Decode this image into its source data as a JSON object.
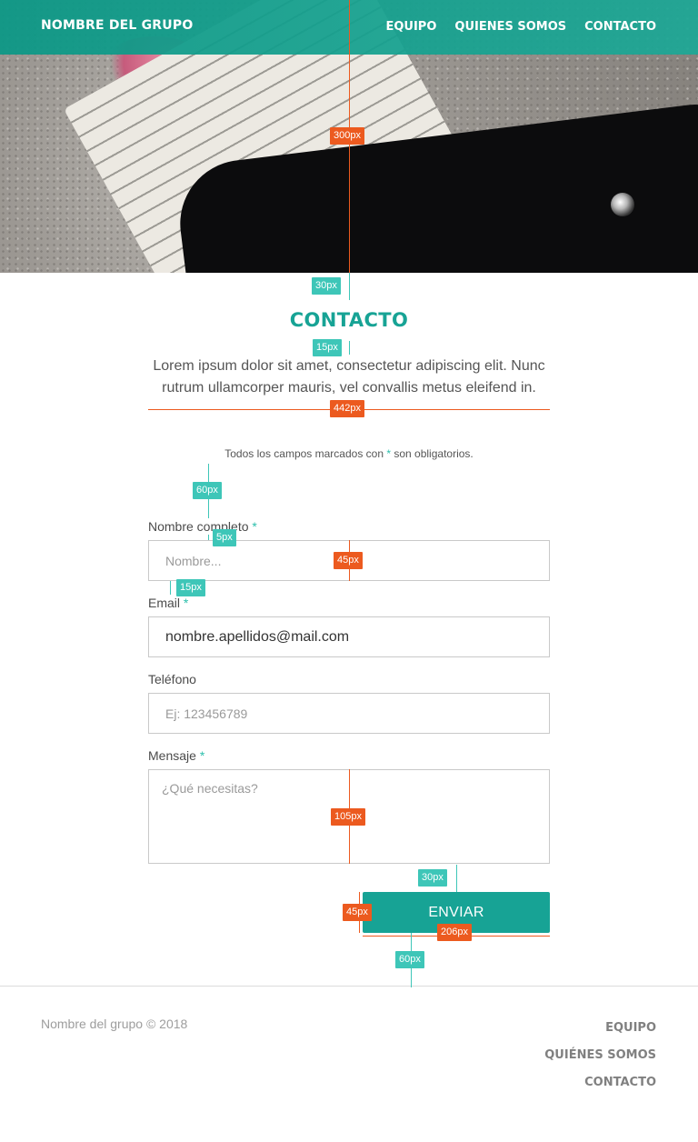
{
  "header": {
    "brand": "NOMBRE DEL GRUPO",
    "nav": [
      "EQUIPO",
      "QUIENES SOMOS",
      "CONTACTO"
    ]
  },
  "section": {
    "title": "CONTACTO",
    "lead": "Lorem ipsum dolor sit amet, consectetur adipiscing elit. Nunc rutrum ullamcorper mauris, vel convallis metus eleifend in.",
    "required_note_before": "Todos los campos marcados con",
    "required_note_star": "*",
    "required_note_after": "son obligatorios."
  },
  "form": {
    "name_label": "Nombre completo",
    "name_placeholder": "Nombre...",
    "email_label": "Email",
    "email_value": "nombre.apellidos@mail.com",
    "phone_label": "Teléfono",
    "phone_placeholder": "Ej: 123456789",
    "message_label": "Mensaje",
    "message_placeholder": "¿Qué necesitas?",
    "required_star": "*",
    "submit_label": "ENVIAR"
  },
  "footer": {
    "copyright": "Nombre del grupo © 2018",
    "nav": [
      "EQUIPO",
      "QUIÉNES SOMOS",
      "CONTACTO"
    ]
  },
  "spec_annotations": [
    "300px",
    "30px",
    "15px",
    "442px",
    "60px",
    "5px",
    "45px",
    "15px",
    "105px",
    "30px",
    "45px",
    "206px",
    "60px"
  ],
  "colors": {
    "accent": "#17a395",
    "spec_orange": "#ec5a1f",
    "spec_teal": "#3ec6b8"
  }
}
